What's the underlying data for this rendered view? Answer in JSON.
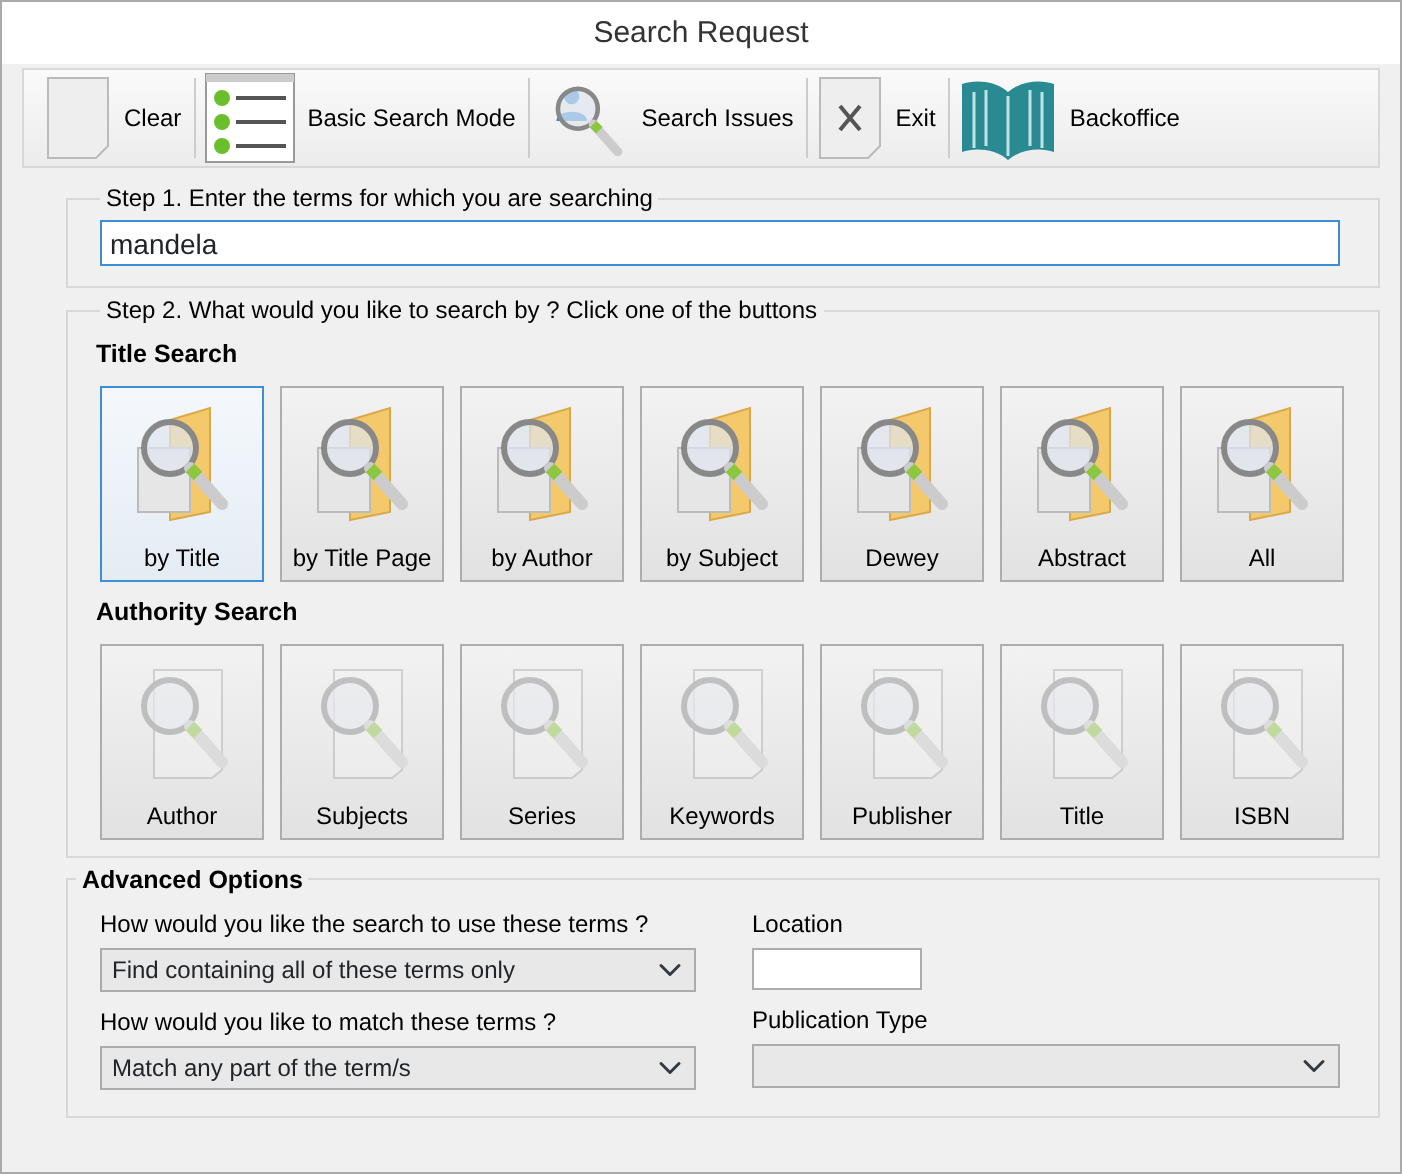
{
  "window": {
    "title": "Search Request"
  },
  "toolbar": [
    {
      "label": "Clear",
      "kind": "page"
    },
    {
      "label": "Basic Search Mode",
      "kind": "checklist"
    },
    {
      "label": "Search Issues",
      "kind": "search-user"
    },
    {
      "label": "Exit",
      "kind": "x-page"
    },
    {
      "label": "Backoffice",
      "kind": "book"
    }
  ],
  "step1": {
    "legend": "Step 1. Enter the terms for which you are searching",
    "value": "mandela"
  },
  "step2": {
    "legend": "Step 2. What would you like to search by ? Click one of the buttons",
    "groups": [
      {
        "heading": "Title Search",
        "kind": "folder",
        "buttons": [
          {
            "label": "by Title",
            "selected": true,
            "disabled": false
          },
          {
            "label": "by Title Page",
            "selected": false,
            "disabled": false
          },
          {
            "label": "by Author",
            "selected": false,
            "disabled": false
          },
          {
            "label": "by Subject",
            "selected": false,
            "disabled": false
          },
          {
            "label": "Dewey",
            "selected": false,
            "disabled": false
          },
          {
            "label": "Abstract",
            "selected": false,
            "disabled": false
          },
          {
            "label": "All",
            "selected": false,
            "disabled": false
          }
        ]
      },
      {
        "heading": "Authority Search",
        "kind": "document",
        "buttons": [
          {
            "label": "Author",
            "selected": false,
            "disabled": true
          },
          {
            "label": "Subjects",
            "selected": false,
            "disabled": true
          },
          {
            "label": "Series",
            "selected": false,
            "disabled": true
          },
          {
            "label": "Keywords",
            "selected": false,
            "disabled": true
          },
          {
            "label": "Publisher",
            "selected": false,
            "disabled": true
          },
          {
            "label": "Title",
            "selected": false,
            "disabled": true
          },
          {
            "label": "ISBN",
            "selected": false,
            "disabled": true
          }
        ]
      }
    ]
  },
  "advanced": {
    "legend": "Advanced Options",
    "left": [
      {
        "label": "How would you like the search to use these terms ?",
        "kind": "select",
        "value": "Find containing all of these terms only"
      },
      {
        "label": "How would you like to match these terms ?",
        "kind": "select",
        "value": "Match any part of the term/s"
      }
    ],
    "right": [
      {
        "label": "Location",
        "kind": "input"
      },
      {
        "label": "Publication Type",
        "kind": "select"
      }
    ]
  }
}
